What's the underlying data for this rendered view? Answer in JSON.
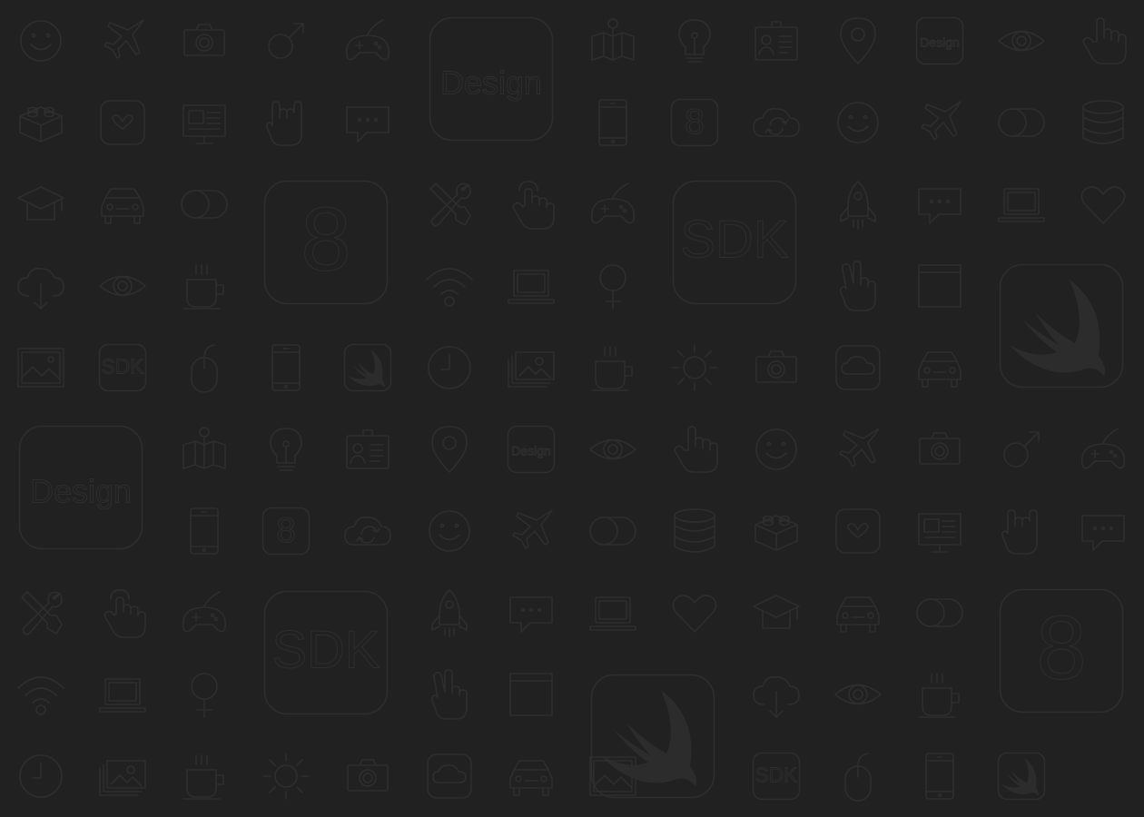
{
  "background_color": "#212121",
  "icon_color": "#2e2e2e",
  "tile_labels": {
    "design": "Design",
    "sdk": "SDK",
    "eight": "8"
  },
  "icons": [
    {
      "name": "smiley-icon",
      "type": "smiley"
    },
    {
      "name": "airplane-icon",
      "type": "plane"
    },
    {
      "name": "camera-icon",
      "type": "camera"
    },
    {
      "name": "male-symbol-icon",
      "type": "male"
    },
    {
      "name": "gamepad-icon",
      "type": "gamepad"
    },
    {
      "name": "design-tile-icon",
      "type": "design",
      "big": true
    },
    {
      "name": "map-icon",
      "type": "map"
    },
    {
      "name": "lightbulb-icon",
      "type": "bulb"
    },
    {
      "name": "id-card-icon",
      "type": "idcard"
    },
    {
      "name": "location-pin-icon",
      "type": "pin"
    },
    {
      "name": "design-tile-small-icon",
      "type": "design"
    },
    {
      "name": "eye-icon",
      "type": "eye"
    },
    {
      "name": "pointing-hand-icon",
      "type": "hand"
    },
    {
      "name": "lego-brick-icon",
      "type": "lego"
    },
    {
      "name": "heart-tile-icon",
      "type": "hearttile"
    },
    {
      "name": "presentation-board-icon",
      "type": "board"
    },
    {
      "name": "rock-hand-icon",
      "type": "rock"
    },
    {
      "name": "chat-bubble-icon",
      "type": "chat"
    },
    {
      "name": "smartphone-icon",
      "type": "phone"
    },
    {
      "name": "eight-tile-small-icon",
      "type": "eight"
    },
    {
      "name": "cloud-sync-icon",
      "type": "cloudsync"
    },
    {
      "name": "smiley-icon",
      "type": "smiley"
    },
    {
      "name": "airplane-icon",
      "type": "plane"
    },
    {
      "name": "toggle-switch-icon",
      "type": "toggle"
    },
    {
      "name": "database-icon",
      "type": "database"
    },
    {
      "name": "graduation-cap-icon",
      "type": "grad"
    },
    {
      "name": "car-icon",
      "type": "car"
    },
    {
      "name": "toggle-switch-icon",
      "type": "toggle"
    },
    {
      "name": "eight-tile-icon",
      "type": "eight",
      "big": true
    },
    {
      "name": "tools-icon",
      "type": "tools"
    },
    {
      "name": "tap-hand-icon",
      "type": "tap"
    },
    {
      "name": "gamepad-icon",
      "type": "gamepad"
    },
    {
      "name": "sdk-tile-icon",
      "type": "sdk",
      "big": true
    },
    {
      "name": "rocket-icon",
      "type": "rocket"
    },
    {
      "name": "chat-bubble-icon",
      "type": "chat"
    },
    {
      "name": "laptop-icon",
      "type": "laptop"
    },
    {
      "name": "heart-icon",
      "type": "heart"
    },
    {
      "name": "cloud-download-icon",
      "type": "clouddown"
    },
    {
      "name": "eye-icon",
      "type": "eye"
    },
    {
      "name": "coffee-cup-icon",
      "type": "coffee"
    },
    {
      "name": "wifi-icon",
      "type": "wifi"
    },
    {
      "name": "laptop-icon",
      "type": "laptop"
    },
    {
      "name": "female-symbol-icon",
      "type": "female"
    },
    {
      "name": "peace-hand-icon",
      "type": "peace"
    },
    {
      "name": "browser-window-icon",
      "type": "window"
    },
    {
      "name": "swift-logo-tile-icon",
      "type": "swift",
      "big": true
    },
    {
      "name": "picture-icon",
      "type": "picture"
    },
    {
      "name": "sdk-tile-small-icon",
      "type": "sdk"
    },
    {
      "name": "mouse-icon",
      "type": "mouse"
    },
    {
      "name": "smartphone-icon",
      "type": "phone"
    },
    {
      "name": "swift-logo-tile-small-icon",
      "type": "swift"
    },
    {
      "name": "clock-icon",
      "type": "clock"
    },
    {
      "name": "photos-icon",
      "type": "photos"
    },
    {
      "name": "coffee-cup-icon",
      "type": "coffee"
    },
    {
      "name": "sun-icon",
      "type": "sun"
    },
    {
      "name": "camera-icon",
      "type": "camera"
    },
    {
      "name": "cloud-tile-icon",
      "type": "cloudtile"
    },
    {
      "name": "car-icon",
      "type": "car"
    },
    {
      "name": "design-tile-icon",
      "type": "design",
      "big": true
    },
    {
      "name": "map-icon",
      "type": "map"
    },
    {
      "name": "lightbulb-icon",
      "type": "bulb"
    },
    {
      "name": "id-card-icon",
      "type": "idcard"
    },
    {
      "name": "location-pin-icon",
      "type": "pin"
    },
    {
      "name": "design-tile-small-icon",
      "type": "design"
    },
    {
      "name": "eye-icon",
      "type": "eye"
    },
    {
      "name": "pointing-hand-icon",
      "type": "hand"
    },
    {
      "name": "smiley-icon",
      "type": "smiley"
    },
    {
      "name": "airplane-icon",
      "type": "plane"
    },
    {
      "name": "camera-icon",
      "type": "camera"
    },
    {
      "name": "male-symbol-icon",
      "type": "male"
    },
    {
      "name": "gamepad-icon",
      "type": "gamepad"
    },
    {
      "name": "smartphone-icon",
      "type": "phone"
    },
    {
      "name": "eight-tile-small-icon",
      "type": "eight"
    },
    {
      "name": "cloud-sync-icon",
      "type": "cloudsync"
    },
    {
      "name": "smiley-icon",
      "type": "smiley"
    },
    {
      "name": "airplane-icon",
      "type": "plane"
    },
    {
      "name": "toggle-switch-icon",
      "type": "toggle"
    },
    {
      "name": "database-icon",
      "type": "database"
    },
    {
      "name": "lego-brick-icon",
      "type": "lego"
    },
    {
      "name": "heart-tile-icon",
      "type": "hearttile"
    },
    {
      "name": "presentation-board-icon",
      "type": "board"
    },
    {
      "name": "rock-hand-icon",
      "type": "rock"
    },
    {
      "name": "chat-bubble-icon",
      "type": "chat"
    },
    {
      "name": "tools-icon",
      "type": "tools"
    },
    {
      "name": "tap-hand-icon",
      "type": "tap"
    },
    {
      "name": "gamepad-icon",
      "type": "gamepad"
    },
    {
      "name": "sdk-tile-icon",
      "type": "sdk",
      "big": true
    },
    {
      "name": "rocket-icon",
      "type": "rocket"
    },
    {
      "name": "chat-bubble-icon",
      "type": "chat"
    },
    {
      "name": "laptop-icon",
      "type": "laptop"
    },
    {
      "name": "heart-icon",
      "type": "heart"
    },
    {
      "name": "graduation-cap-icon",
      "type": "grad"
    },
    {
      "name": "car-icon",
      "type": "car"
    },
    {
      "name": "toggle-switch-icon",
      "type": "toggle"
    },
    {
      "name": "eight-tile-icon",
      "type": "eight",
      "big": true
    },
    {
      "name": "wifi-icon",
      "type": "wifi"
    },
    {
      "name": "laptop-icon",
      "type": "laptop"
    },
    {
      "name": "female-symbol-icon",
      "type": "female"
    },
    {
      "name": "peace-hand-icon",
      "type": "peace"
    },
    {
      "name": "browser-window-icon",
      "type": "window"
    },
    {
      "name": "swift-logo-tile-icon",
      "type": "swift",
      "big": true
    },
    {
      "name": "cloud-download-icon",
      "type": "clouddown"
    },
    {
      "name": "eye-icon",
      "type": "eye"
    },
    {
      "name": "coffee-cup-icon",
      "type": "coffee"
    },
    {
      "name": "clock-icon",
      "type": "clock"
    },
    {
      "name": "photos-icon",
      "type": "photos"
    },
    {
      "name": "coffee-cup-icon",
      "type": "coffee"
    },
    {
      "name": "sun-icon",
      "type": "sun"
    },
    {
      "name": "camera-icon",
      "type": "camera"
    },
    {
      "name": "cloud-tile-icon",
      "type": "cloudtile"
    },
    {
      "name": "car-icon",
      "type": "car"
    },
    {
      "name": "picture-icon",
      "type": "picture"
    },
    {
      "name": "sdk-tile-small-icon",
      "type": "sdk"
    },
    {
      "name": "mouse-icon",
      "type": "mouse"
    },
    {
      "name": "smartphone-icon",
      "type": "phone"
    },
    {
      "name": "swift-logo-tile-small-icon",
      "type": "swift"
    }
  ]
}
